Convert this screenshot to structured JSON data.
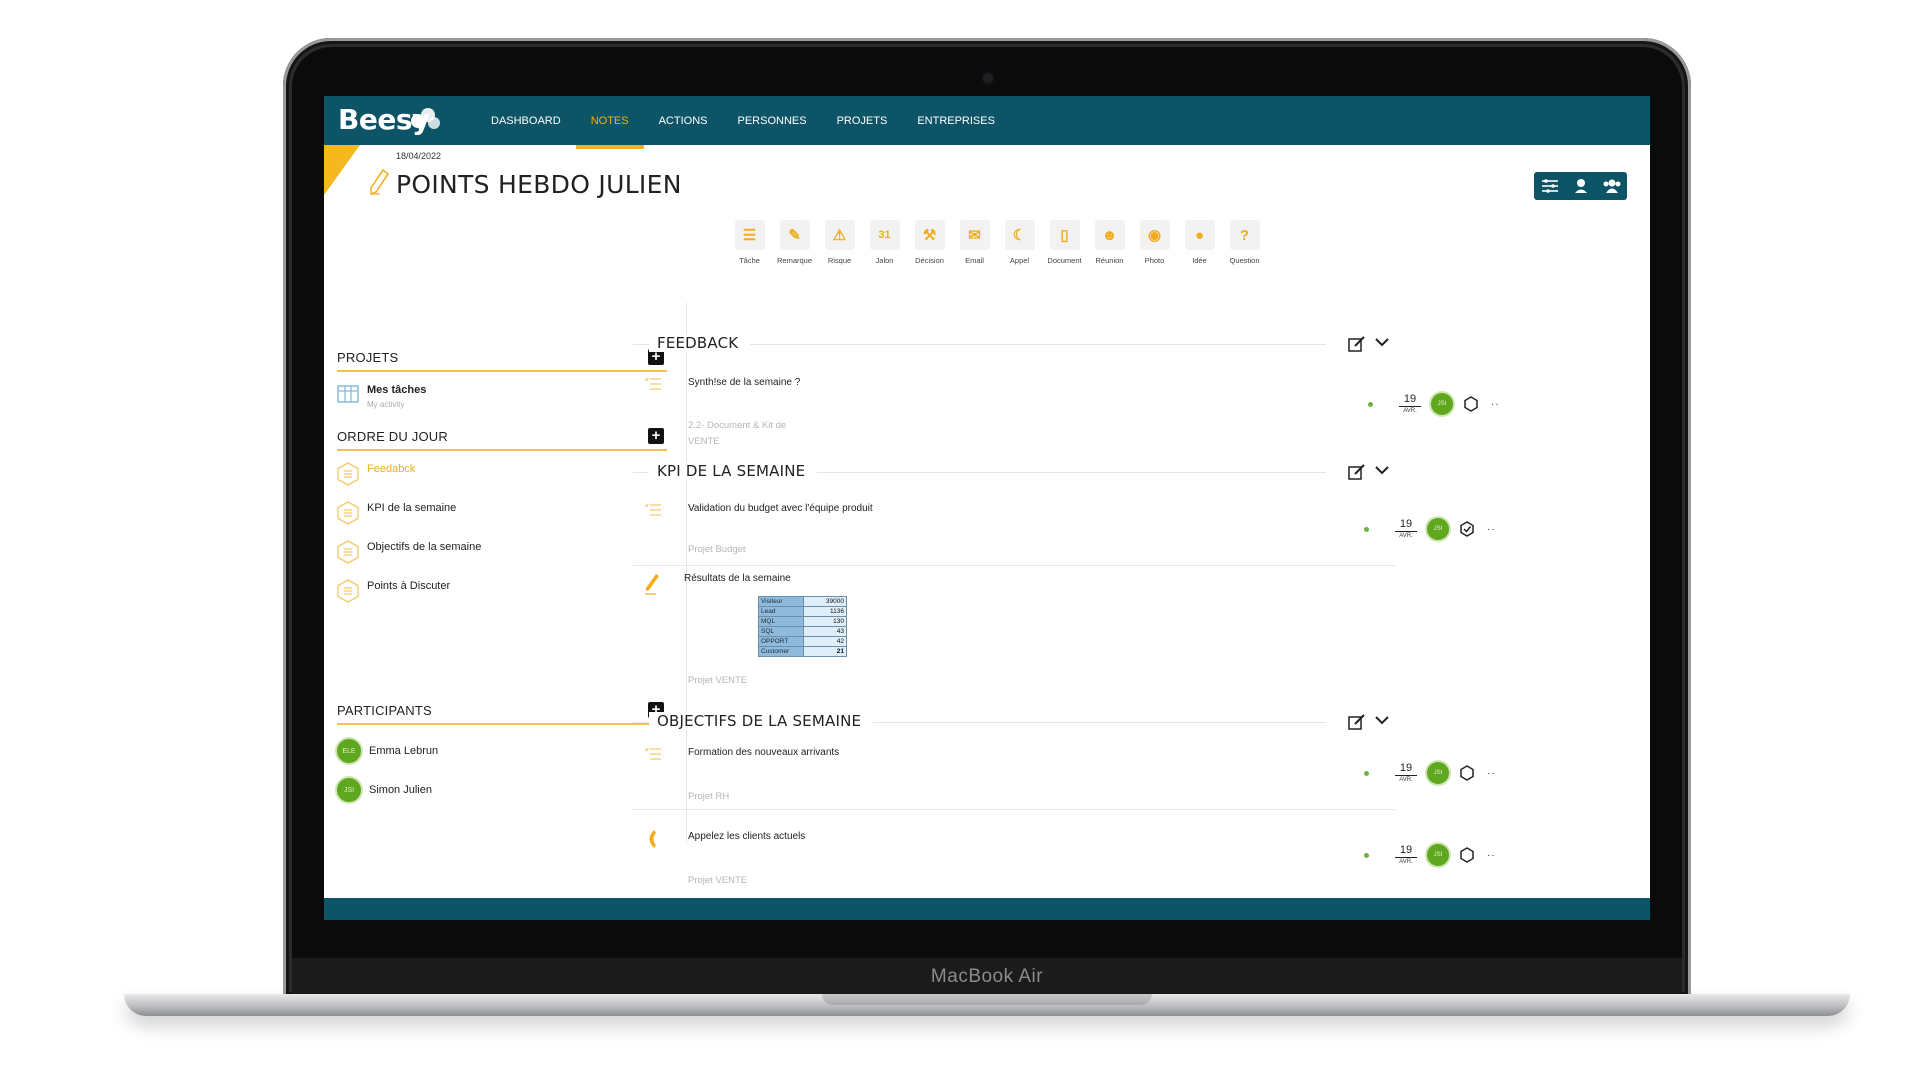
{
  "device": {
    "label": "MacBook Air"
  },
  "app": {
    "name": "Beesy"
  },
  "nav": {
    "items": [
      "DASHBOARD",
      "NOTES",
      "ACTIONS",
      "PERSONNES",
      "PROJETS",
      "ENTREPRISES"
    ],
    "active": "NOTES"
  },
  "note": {
    "date": "18/04/2022",
    "title": "POINTS HEBDO JULIEN"
  },
  "palette": [
    {
      "label": "Tâche",
      "icon": "task-list-icon"
    },
    {
      "label": "Remarque",
      "icon": "pencil-icon"
    },
    {
      "label": "Risque",
      "icon": "warning-icon"
    },
    {
      "label": "Jalon",
      "icon": "calendar-31-icon"
    },
    {
      "label": "Décision",
      "icon": "gavel-icon"
    },
    {
      "label": "Email",
      "icon": "envelope-icon"
    },
    {
      "label": "Appel",
      "icon": "phone-icon"
    },
    {
      "label": "Document",
      "icon": "document-icon"
    },
    {
      "label": "Réunion",
      "icon": "meeting-icon"
    },
    {
      "label": "Photo",
      "icon": "camera-icon"
    },
    {
      "label": "Idée",
      "icon": "lightbulb-icon"
    },
    {
      "label": "Question",
      "icon": "question-icon"
    }
  ],
  "sidebar": {
    "projets": {
      "title": "PROJETS",
      "items": [
        {
          "label": "Mes tâches",
          "sub": "My activity"
        }
      ]
    },
    "ordre": {
      "title": "ORDRE DU JOUR",
      "items": [
        "Feedabck",
        "KPI de la semaine",
        "Objectifs de la semaine",
        "Points à Discuter"
      ],
      "active": "Feedabck"
    },
    "participants": {
      "title": "PARTICIPANTS",
      "items": [
        {
          "initials": "ELE",
          "name": "Emma Lebrun"
        },
        {
          "initials": "JSI",
          "name": "Simon Julien"
        }
      ]
    }
  },
  "groups": [
    {
      "title": "FEEDBACK",
      "items": [
        {
          "type": "task-list-icon",
          "title": "Synth!se de la semaine ?",
          "project": "2.2- Document & Kit de VENTE",
          "day": "19",
          "month": "AVR.",
          "initials": "JSI"
        }
      ]
    },
    {
      "title": "KPI DE LA SEMAINE",
      "items": [
        {
          "type": "task-list-icon",
          "title": "Validation du budget avec l'équipe produit",
          "project": "Projet Budget",
          "day": "19",
          "month": "AVR.",
          "initials": "JSI"
        },
        {
          "type": "pencil-icon",
          "title": "Résultats de la semaine",
          "project": "Projet  VENTE"
        }
      ]
    },
    {
      "title": "OBJECTIFS DE LA SEMAINE",
      "items": [
        {
          "type": "task-list-icon",
          "title": "Formation des nouveaux arrivants",
          "project": "Projet RH",
          "day": "19",
          "month": "AVR.",
          "initials": "JSI"
        },
        {
          "type": "phone-icon",
          "title": "Appelez les clients actuels",
          "project": "Projet VENTE",
          "day": "19",
          "month": "AVR.",
          "initials": "JSI"
        }
      ]
    }
  ],
  "kpi_table": [
    {
      "label": "Visiteur",
      "value": "39000"
    },
    {
      "label": "Lead",
      "value": "1136"
    },
    {
      "label": "MQL",
      "value": "130"
    },
    {
      "label": "SQL",
      "value": "43"
    },
    {
      "label": "OPPORT",
      "value": "42"
    },
    {
      "label": "Customer",
      "value": "21"
    }
  ],
  "colors": {
    "brand": "#0e5467",
    "accent": "#f1b21b",
    "avatar": "#5ea71f"
  }
}
